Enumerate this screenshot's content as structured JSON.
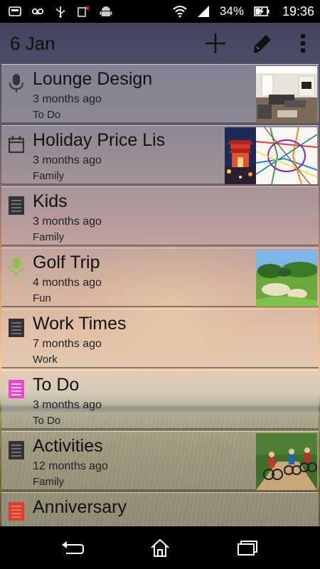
{
  "status_bar": {
    "left_icons": [
      "voicemail-icon",
      "tape-icon",
      "usb-icon",
      "no-signal-icon",
      "android-icon"
    ],
    "battery": "34%",
    "time": "19:36"
  },
  "header": {
    "date": "6 Jan",
    "actions": [
      "add-icon",
      "pen-icon",
      "overflow-menu-icon"
    ]
  },
  "notes": [
    {
      "title": "Lounge Design",
      "time": "3 months ago",
      "category": "To Do",
      "icon": "microphone-icon",
      "icon_color": "#333333",
      "thumbnail": "living-room-photo"
    },
    {
      "title": "Holiday Price Lis",
      "time": "3 months ago",
      "category": "Family",
      "icon": "calendar-icon",
      "icon_color": "#333333",
      "thumbnail": "temple-and-metro-map-photos"
    },
    {
      "title": "Kids",
      "time": "3 months ago",
      "category": "Family",
      "icon": "note-lines-icon",
      "icon_color": "#333333",
      "thumbnail": ""
    },
    {
      "title": "Golf Trip",
      "time": "4 months ago",
      "category": "Fun",
      "icon": "microphone-icon",
      "icon_color": "#8bc34a",
      "thumbnail": "golf-course-photo"
    },
    {
      "title": "Work Times",
      "time": "7 months ago",
      "category": "Work",
      "icon": "note-lines-icon",
      "icon_color": "#333333",
      "thumbnail": ""
    },
    {
      "title": "To Do",
      "time": "3 months ago",
      "category": "To Do",
      "icon": "note-lines-icon",
      "icon_color": "#ee44cc",
      "thumbnail": ""
    },
    {
      "title": "Activities",
      "time": "12 months ago",
      "category": "Family",
      "icon": "note-lines-icon",
      "icon_color": "#333333",
      "thumbnail": "cyclists-photo"
    },
    {
      "title": "Anniversary",
      "time": "",
      "category": "",
      "icon": "note-lines-icon",
      "icon_color": "#d9412b",
      "thumbnail": ""
    }
  ],
  "nav": [
    "back-icon",
    "home-icon",
    "recent-apps-icon"
  ]
}
